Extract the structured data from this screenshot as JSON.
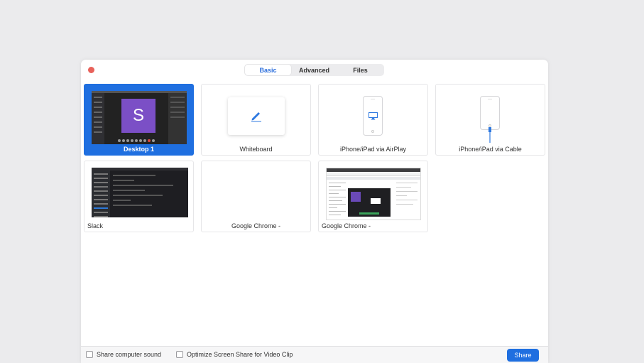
{
  "tabs": [
    {
      "label": "Basic",
      "active": true
    },
    {
      "label": "Advanced",
      "active": false
    },
    {
      "label": "Files",
      "active": false
    }
  ],
  "tiles": [
    {
      "label": "Desktop 1",
      "selected": true,
      "thumb_letter": "S"
    },
    {
      "label": "Whiteboard",
      "selected": false
    },
    {
      "label": "iPhone/iPad via AirPlay",
      "selected": false
    },
    {
      "label": "iPhone/iPad via Cable",
      "selected": false
    },
    {
      "label": "Slack",
      "selected": false
    },
    {
      "label": "Google Chrome -",
      "selected": false
    },
    {
      "label": "Google Chrome -",
      "selected": false
    }
  ],
  "footer": {
    "share_sound": "Share computer sound",
    "optimize_video": "Optimize Screen Share for Video Clip",
    "share_button": "Share"
  },
  "colors": {
    "accent": "#1f6fe0",
    "close": "#e8615a",
    "avatar": "#7b4fc6"
  }
}
